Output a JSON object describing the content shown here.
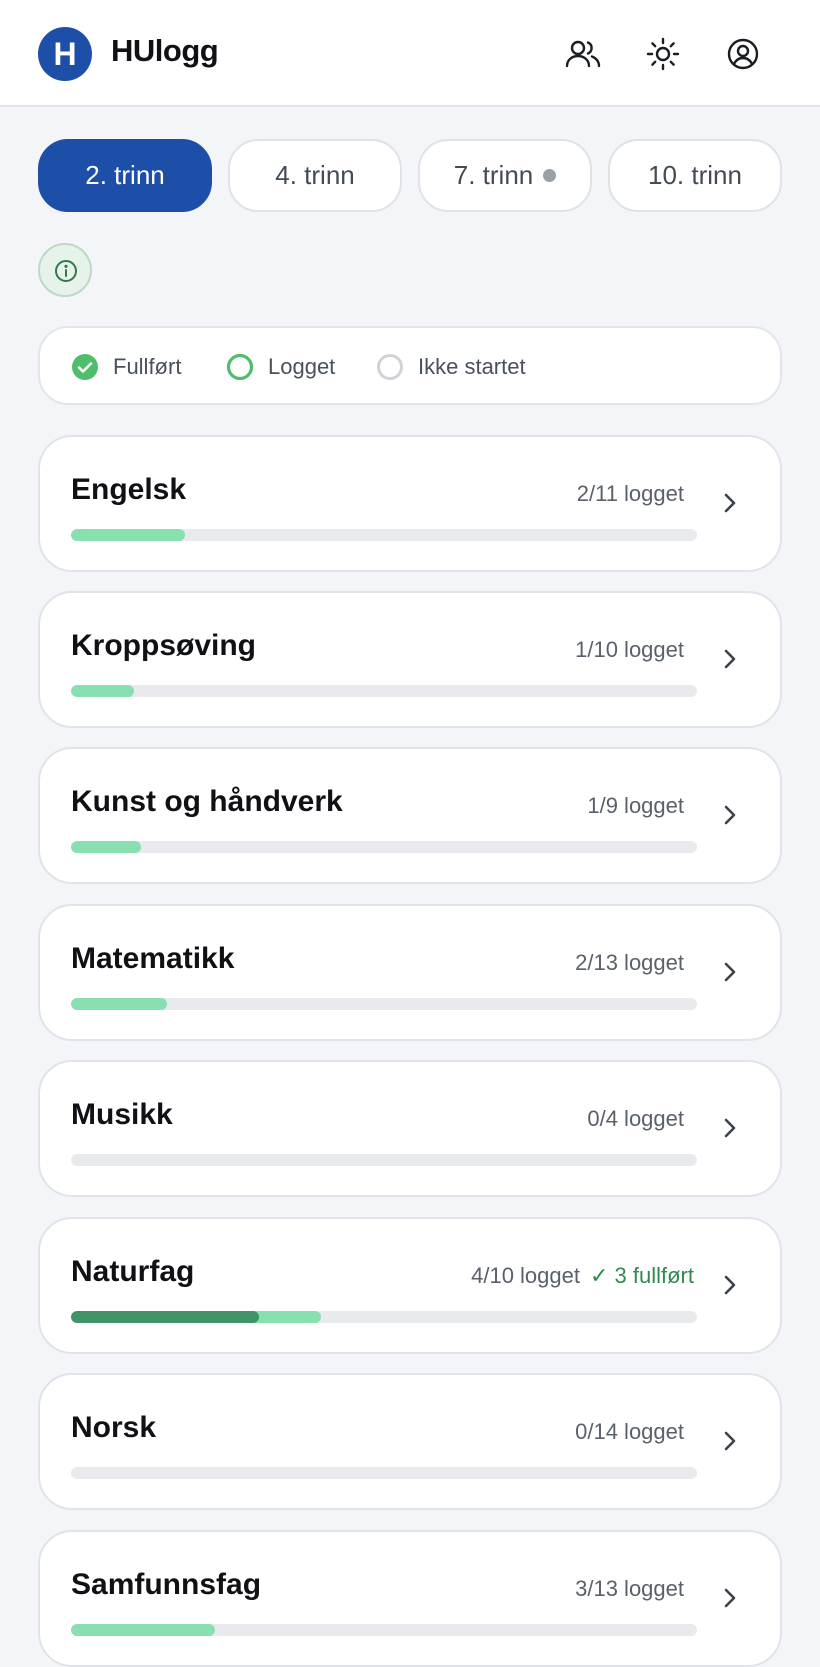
{
  "header": {
    "logo_letter": "H",
    "title": "HUlogg",
    "icons": [
      "users-icon",
      "sun-icon",
      "account-icon"
    ]
  },
  "tabs": [
    {
      "label": "2. trinn",
      "active": true,
      "dot": false
    },
    {
      "label": "4. trinn",
      "active": false,
      "dot": false
    },
    {
      "label": "7. trinn",
      "active": false,
      "dot": true
    },
    {
      "label": "10. trinn",
      "active": false,
      "dot": false
    }
  ],
  "info_icon": "info-icon",
  "legend": [
    {
      "label": "Fullført",
      "icon": "filled-check-circle-icon"
    },
    {
      "label": "Logget",
      "icon": "green-ring-icon"
    },
    {
      "label": "Ikke startet",
      "icon": "gray-ring-icon"
    }
  ],
  "subjects": [
    {
      "name": "Engelsk",
      "count": "2/11 logget",
      "done": "",
      "logged": 2,
      "completed": 0,
      "total": 11
    },
    {
      "name": "Kroppsøving",
      "count": "1/10 logget",
      "done": "",
      "logged": 1,
      "completed": 0,
      "total": 10
    },
    {
      "name": "Kunst og håndverk",
      "count": "1/9 logget",
      "done": "",
      "logged": 1,
      "completed": 0,
      "total": 9
    },
    {
      "name": "Matematikk",
      "count": "2/13 logget",
      "done": "",
      "logged": 2,
      "completed": 0,
      "total": 13
    },
    {
      "name": "Musikk",
      "count": "0/4 logget",
      "done": "",
      "logged": 0,
      "completed": 0,
      "total": 4
    },
    {
      "name": "Naturfag",
      "count": "4/10 logget",
      "done": "✓ 3 fullført",
      "logged": 4,
      "completed": 3,
      "total": 10
    },
    {
      "name": "Norsk",
      "count": "0/14 logget",
      "done": "",
      "logged": 0,
      "completed": 0,
      "total": 14
    },
    {
      "name": "Samfunnsfag",
      "count": "3/13 logget",
      "done": "",
      "logged": 3,
      "completed": 0,
      "total": 13
    }
  ],
  "colors": {
    "brand": "#1e4fa8",
    "logged_bar": "#88e0b0",
    "completed_bar": "#3f946a",
    "completed_text": "#2f8a4f"
  }
}
